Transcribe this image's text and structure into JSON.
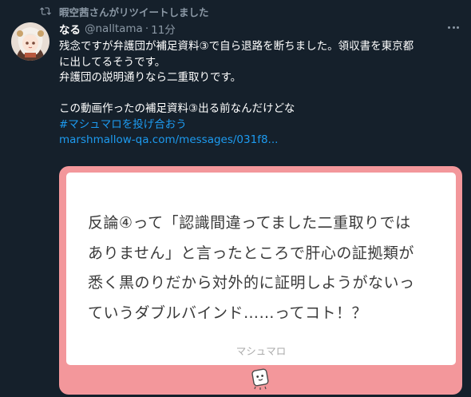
{
  "retweet_context": {
    "text": "暇空茜さんがリツイートしました",
    "icon": "retweet-icon"
  },
  "author": {
    "display_name": "なる",
    "handle": "@nalltama",
    "separator": "·",
    "time": "11分",
    "avatar": "anime-character-avatar"
  },
  "more_icon": "more-dots-icon",
  "body": {
    "line1": "残念ですが弁護団が補足資料③で自ら退路を断ちました。領収書を東京都",
    "line2": "に出してるそうです。",
    "line3": "弁護団の説明通りなら二重取りです。",
    "line4": "この動画作ったの補足資料③出る前なんだけどな",
    "hashtag": "#マシュマロを投げ合おう",
    "url": "marshmallow-qa.com/messages/031f8..."
  },
  "card": {
    "question_lines": [
      "反論④って「認識間違ってました二重取りでは",
      "ありません」と言ったところで肝心の証拠類が",
      "悉く黒のりだから対外的に証明しようがないっ",
      "ていうダブルバインド……ってコト！？"
    ],
    "brand": "マシュマロ",
    "background_color": "#f3979b",
    "mascot_icon": "marshmallow-mascot-icon"
  },
  "colors": {
    "background": "#15202b",
    "secondary_text": "#8b98a5",
    "link": "#1d9bf0",
    "primary_text": "#ffffff"
  }
}
